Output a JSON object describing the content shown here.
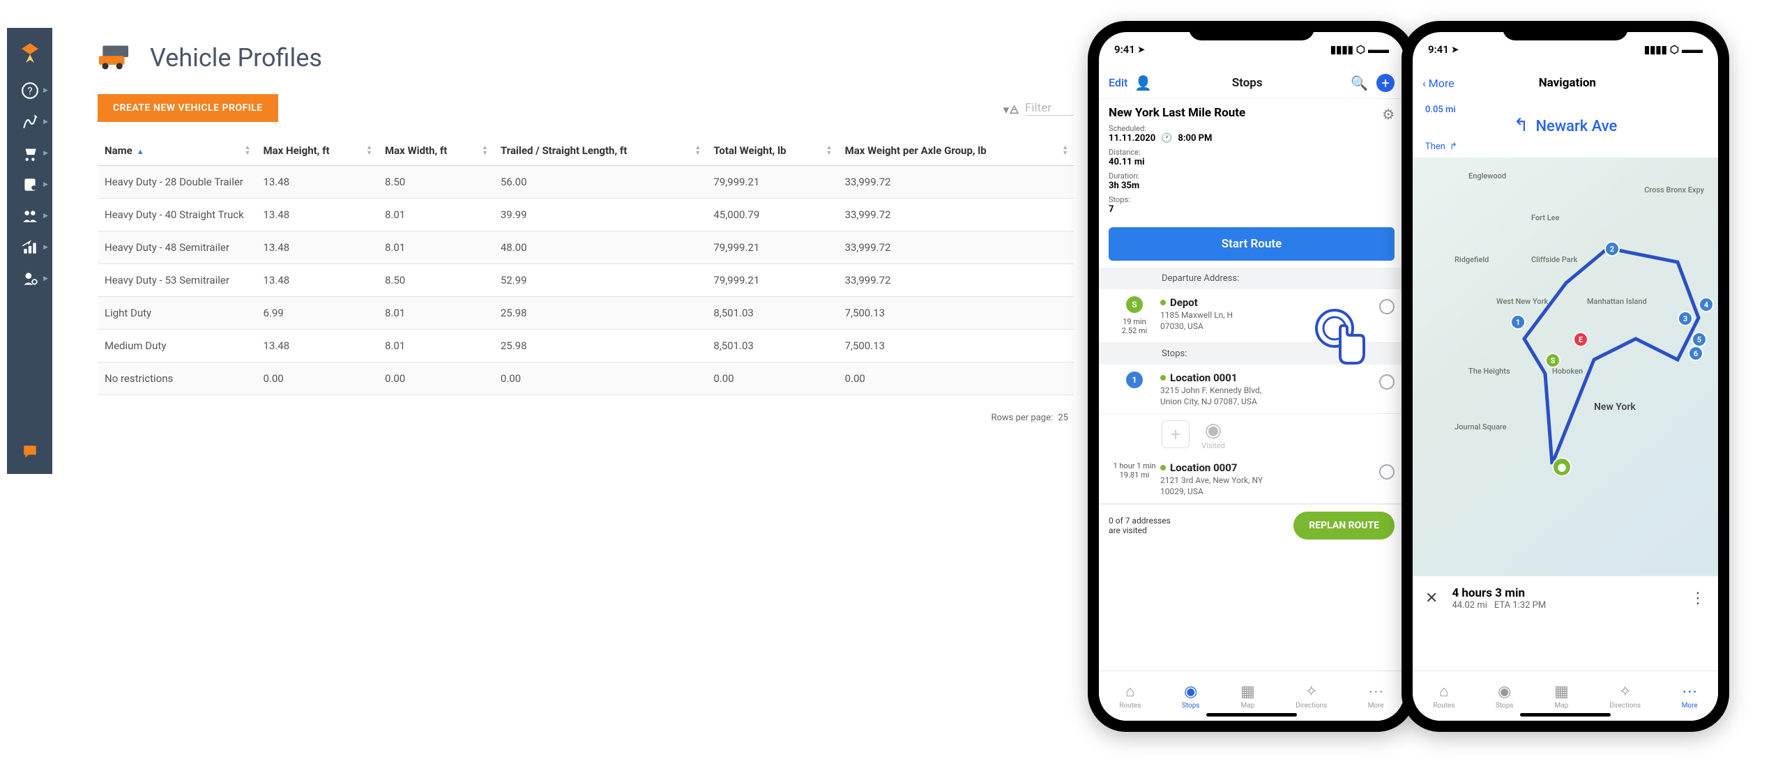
{
  "page": {
    "title": "Vehicle Profiles",
    "create_button": "CREATE NEW VEHICLE PROFILE",
    "filter_placeholder": "Filter",
    "rows_per_page_label": "Rows per page:",
    "rows_per_page_value": "25"
  },
  "table": {
    "columns": [
      "Name",
      "Max Height, ft",
      "Max Width, ft",
      "Trailed / Straight Length, ft",
      "Total Weight, lb",
      "Max Weight per Axle Group, lb"
    ],
    "rows": [
      {
        "name": "Heavy Duty - 28 Double Trailer",
        "max_height": "13.48",
        "max_width": "8.50",
        "length": "56.00",
        "total_weight": "79,999.21",
        "max_axle": "33,999.72"
      },
      {
        "name": "Heavy Duty - 40 Straight Truck",
        "max_height": "13.48",
        "max_width": "8.01",
        "length": "39.99",
        "total_weight": "45,000.79",
        "max_axle": "33,999.72"
      },
      {
        "name": "Heavy Duty - 48 Semitrailer",
        "max_height": "13.48",
        "max_width": "8.01",
        "length": "48.00",
        "total_weight": "79,999.21",
        "max_axle": "33,999.72"
      },
      {
        "name": "Heavy Duty - 53 Semitrailer",
        "max_height": "13.48",
        "max_width": "8.50",
        "length": "52.99",
        "total_weight": "79,999.21",
        "max_axle": "33,999.72"
      },
      {
        "name": "Light Duty",
        "max_height": "6.99",
        "max_width": "8.01",
        "length": "25.98",
        "total_weight": "8,501.03",
        "max_axle": "7,500.13"
      },
      {
        "name": "Medium Duty",
        "max_height": "13.48",
        "max_width": "8.01",
        "length": "25.98",
        "total_weight": "8,501.03",
        "max_axle": "7,500.13"
      },
      {
        "name": "No restrictions",
        "max_height": "0.00",
        "max_width": "0.00",
        "length": "0.00",
        "total_weight": "0.00",
        "max_axle": "0.00"
      }
    ]
  },
  "phone1": {
    "time": "9:41",
    "edit": "Edit",
    "title": "Stops",
    "route_name": "New York Last Mile Route",
    "labels": {
      "scheduled": "Scheduled:",
      "distance": "Distance:",
      "duration": "Duration:",
      "stops": "Stops:"
    },
    "scheduled_date": "11.11.2020",
    "scheduled_time": "8:00 PM",
    "distance": "40.11 mi",
    "duration": "3h 35m",
    "stops": "7",
    "start_button": "Start Route",
    "dep_label": "Departure Address:",
    "stops_label": "Stops:",
    "depot": {
      "title": "Depot",
      "addr1": "1185 Maxwell Ln, H",
      "addr2": "07030, USA"
    },
    "leg1": {
      "time": "19 min",
      "dist": "2.52 mi"
    },
    "stop1": {
      "title": "Location 0001",
      "addr1": "3215 John F. Kennedy Blvd,",
      "addr2": "Union City, NJ 07087, USA"
    },
    "visited_label": "Visited",
    "leg2": {
      "time": "1 hour 1 min",
      "dist": "19.81 mi"
    },
    "stop2": {
      "title": "Location 0007",
      "addr1": "2121 3rd Ave, New York, NY",
      "addr2": "10029, USA"
    },
    "visit_count1": "0 of 7 addresses",
    "visit_count2": "are visited",
    "replan_button": "REPLAN ROUTE",
    "tabs": [
      "Routes",
      "Stops",
      "Map",
      "Directions",
      "More"
    ]
  },
  "phone2": {
    "time": "9:41",
    "back": "More",
    "title": "Navigation",
    "step_dist": "0.05 mi",
    "step_road": "Newark Ave",
    "then_label": "Then",
    "places": [
      "Englewood",
      "Fort Lee",
      "Ridgefield",
      "Cliffside Park",
      "West New York",
      "Manhattan Island",
      "The Heights",
      "Hoboken",
      "New York",
      "Journal Square",
      "Cross Bronx Expy"
    ],
    "summary": {
      "duration": "4 hours 3 min",
      "dist": "44.02 mi",
      "eta": "ETA 1:32 PM"
    },
    "tabs": [
      "Routes",
      "Stops",
      "Map",
      "Directions",
      "More"
    ]
  }
}
